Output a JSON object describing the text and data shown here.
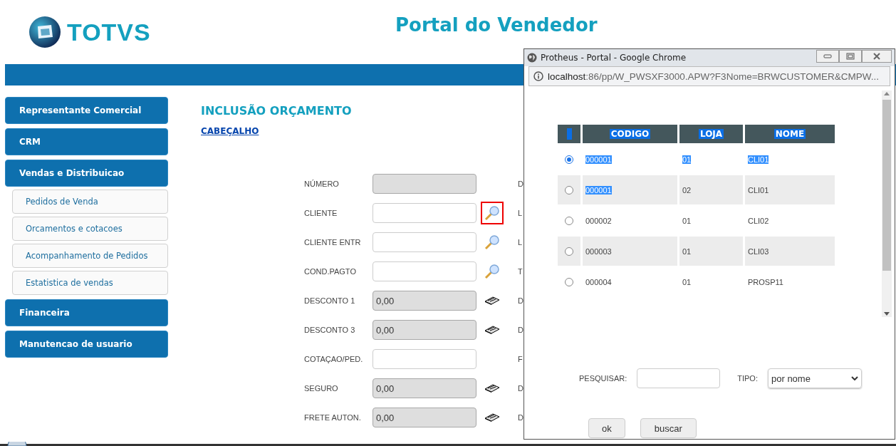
{
  "header": {
    "logo_text": "TOTVS",
    "title": "Portal do Vendedor"
  },
  "sidebar": {
    "items": [
      {
        "label": "Representante Comercial",
        "kind": "section"
      },
      {
        "label": "CRM",
        "kind": "section"
      },
      {
        "label": "Vendas e Distribuicao",
        "kind": "section"
      },
      {
        "label": "Pedidos de Venda",
        "kind": "subitem"
      },
      {
        "label": "Orcamentos e cotacoes",
        "kind": "subitem"
      },
      {
        "label": "Acompanhamento de Pedidos",
        "kind": "subitem"
      },
      {
        "label": "Estatistica de vendas",
        "kind": "subitem"
      },
      {
        "label": "Financeira",
        "kind": "section"
      },
      {
        "label": "Manutencao de usuario",
        "kind": "section"
      }
    ]
  },
  "page": {
    "title": "INCLUSÃO ORÇAMENTO",
    "section_link": "CABEÇALHO"
  },
  "form": {
    "fields": [
      {
        "label": "NÚMERO",
        "disabled": true,
        "side_label": "D"
      },
      {
        "label": "CLIENTE",
        "disabled": false,
        "kind": "lookup",
        "highlighted": true,
        "side_label": "L"
      },
      {
        "label": "CLIENTE ENTR",
        "disabled": false,
        "kind": "lookup",
        "highlighted": false,
        "side_label": "L"
      },
      {
        "label": "COND.PAGTO",
        "disabled": false,
        "kind": "lookup",
        "highlighted": false,
        "side_label": "T"
      },
      {
        "label": "DESCONTO 1",
        "value": "0,00",
        "disabled": true,
        "kind": "calculator",
        "highlighted": false,
        "side_label": "D"
      },
      {
        "label": "DESCONTO 3",
        "value": "0,00",
        "disabled": true,
        "kind": "calculator",
        "highlighted": false,
        "side_label": "D"
      },
      {
        "label": "COTAÇAO/PED.",
        "disabled": false,
        "side_label": "F"
      },
      {
        "label": "SEGURO",
        "value": "0,00",
        "disabled": true,
        "kind": "calculator",
        "highlighted": false,
        "side_label": "D"
      },
      {
        "label": "FRETE AUTON.",
        "value": "0,00",
        "disabled": true,
        "kind": "calculator",
        "highlighted": false,
        "side_label": "D"
      }
    ]
  },
  "popup": {
    "window_title": "Protheus - Portal - Google Chrome",
    "address_host": "localhost",
    "address_path": ":86/pp/W_PWSXF3000.APW?F3Nome=BRWCUSTOMER&CMPW...",
    "table": {
      "selection_header": {
        "highlighted": true
      },
      "columns": [
        {
          "label": "CODIGO",
          "highlighted": true
        },
        {
          "label": "LOJA",
          "highlighted": true
        },
        {
          "label": "NOME",
          "highlighted": true
        }
      ],
      "rows": [
        {
          "selected": true,
          "cells": [
            {
              "text": "000001",
              "highlighted": true
            },
            {
              "text": "01",
              "highlighted": true
            },
            {
              "text": "CLI01",
              "highlighted": true
            }
          ]
        },
        {
          "selected": false,
          "cells": [
            {
              "text": "000001",
              "highlighted": true
            },
            {
              "text": "02",
              "highlighted": false
            },
            {
              "text": "CLI01",
              "highlighted": false
            }
          ]
        },
        {
          "selected": false,
          "cells": [
            {
              "text": "000002",
              "highlighted": false
            },
            {
              "text": "01",
              "highlighted": false
            },
            {
              "text": "CLI02",
              "highlighted": false
            }
          ]
        },
        {
          "selected": false,
          "cells": [
            {
              "text": "000003",
              "highlighted": false
            },
            {
              "text": "01",
              "highlighted": false
            },
            {
              "text": "CLI03",
              "highlighted": false
            }
          ]
        },
        {
          "selected": false,
          "cells": [
            {
              "text": "000004",
              "highlighted": false
            },
            {
              "text": "01",
              "highlighted": false
            },
            {
              "text": "PROSP11",
              "highlighted": false
            }
          ]
        }
      ]
    },
    "search_label": "PESQUISAR:",
    "type_label": "TIPO:",
    "type_value": "por nome",
    "buttons": [
      "ok",
      "buscar"
    ]
  }
}
